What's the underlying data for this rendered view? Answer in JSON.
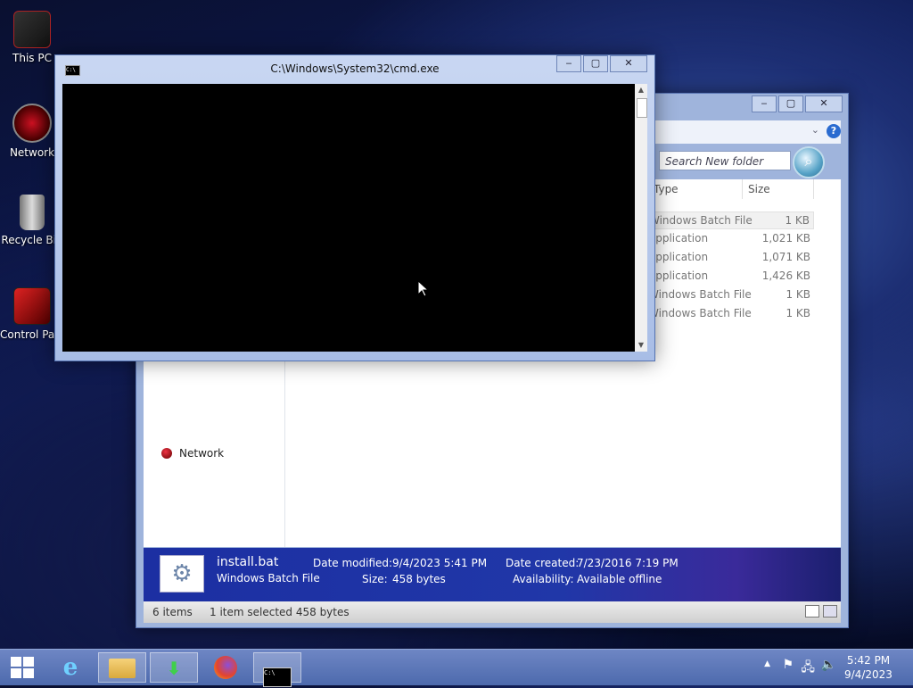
{
  "desktop": {
    "icons": [
      {
        "label": "This PC",
        "icon": "computer-icon"
      },
      {
        "label": "Network",
        "icon": "network-icon"
      },
      {
        "label": "Recycle Bin",
        "icon": "recycle-bin-icon"
      },
      {
        "label": "Control Panel",
        "icon": "control-panel-icon"
      }
    ]
  },
  "cmd": {
    "title": "C:\\Windows\\System32\\cmd.exe",
    "sys_icon_text": "C:\\",
    "minimize": "‒",
    "maximize": "▢",
    "close": "✕"
  },
  "explorer": {
    "minimize": "‒",
    "maximize": "▢",
    "close": "✕",
    "search_placeholder": "Search New folder",
    "help": "?",
    "nav_network": "Network",
    "columns": {
      "type": "Type",
      "size": "Size"
    },
    "files": [
      {
        "type": "Windows Batch File",
        "size": "1 KB",
        "selected": true
      },
      {
        "type": "Application",
        "size": "1,021 KB"
      },
      {
        "type": "Application",
        "size": "1,071 KB"
      },
      {
        "type": "Application",
        "size": "1,426 KB"
      },
      {
        "type": "Windows Batch File",
        "size": "1 KB"
      },
      {
        "type": "Windows Batch File",
        "size": "1 KB"
      }
    ],
    "details": {
      "name": "install.bat",
      "type": "Windows Batch File",
      "date_modified_label": "Date modified:",
      "date_modified": "9/4/2023 5:41 PM",
      "size_label": "Size:",
      "size": "458 bytes",
      "date_created_label": "Date created:",
      "date_created": "7/23/2016 7:19 PM",
      "availability_label": "Availability:",
      "availability": "Available offline"
    },
    "status": {
      "items": "6 items",
      "selected": "1 item selected  458 bytes"
    }
  },
  "taskbar": {
    "time": "5:42 PM",
    "date": "9/4/2023"
  },
  "colors": {
    "taskbar": "#5a75b8",
    "details_bar": "#2037a8",
    "console": "#000000"
  }
}
